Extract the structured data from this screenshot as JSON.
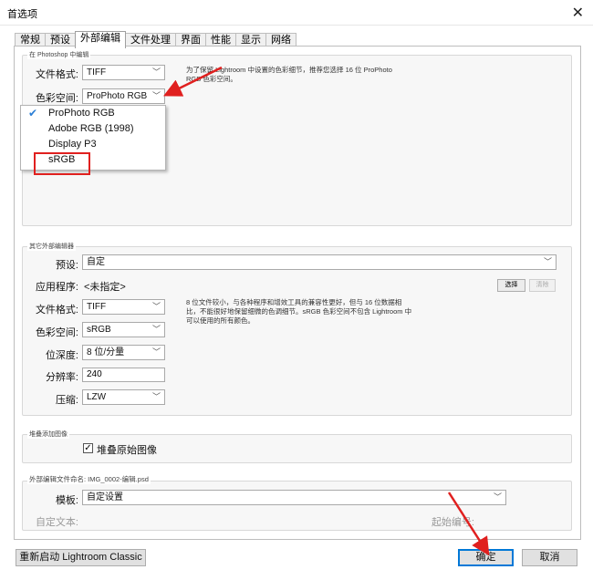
{
  "window": {
    "title": "首选项",
    "close_glyph": "✕"
  },
  "tabs": [
    "常规",
    "预设",
    "外部编辑",
    "文件处理",
    "界面",
    "性能",
    "显示",
    "网络"
  ],
  "photoshop": {
    "group_title": "在 Photoshop 中编辑",
    "file_format_label": "文件格式:",
    "file_format_value": "TIFF",
    "color_space_label": "色彩空间:",
    "color_space_value": "ProPhoto RGB",
    "help_line1": "为了保留 Lightroom 中设置的色彩细节，推荐您选择 16 位 ProPhoto",
    "help_line2": "RGB 色彩空间。",
    "dropdown_options": [
      "ProPhoto RGB",
      "Adobe RGB (1998)",
      "Display P3",
      "sRGB"
    ],
    "selected_option_check": "✔"
  },
  "other": {
    "group_title": "其它外部编辑器",
    "preset_label": "预设:",
    "preset_value": "自定",
    "app_label": "应用程序:",
    "app_value": "<未指定>",
    "choose_btn": "选择",
    "clear_btn": "清除",
    "file_format_label": "文件格式:",
    "file_format_value": "TIFF",
    "color_space_label": "色彩空间:",
    "color_space_value": "sRGB",
    "bit_depth_label": "位深度:",
    "bit_depth_value": "8 位/分量",
    "resolution_label": "分辨率:",
    "resolution_value": "240",
    "compression_label": "压缩:",
    "compression_value": "LZW",
    "help_line1": "8 位文件较小，与各种程序和增效工具的兼容性更好，但与 16 位数据相",
    "help_line2": "比，不能很好地保留细微的色调细节。sRGB 色彩空间不包含 Lightroom 中",
    "help_line3": "可以使用的所有颜色。"
  },
  "stack": {
    "group_title": "堆叠添加图像",
    "checkbox_label": "堆叠原始图像",
    "checked": "✓"
  },
  "naming": {
    "group_title": "外部编辑文件命名: IMG_0002-编辑.psd",
    "template_label": "模板:",
    "template_value": "自定设置",
    "custom_text_label": "自定文本:",
    "start_number_label": "起始编号:"
  },
  "footer": {
    "restart_btn": "重新启动 Lightroom Classic",
    "ok_btn": "确定",
    "cancel_btn": "取消"
  },
  "icons": {
    "chevron": "﹀"
  },
  "colors": {
    "annotation_red": "#e0201f",
    "accent_blue": "#0078d7"
  }
}
